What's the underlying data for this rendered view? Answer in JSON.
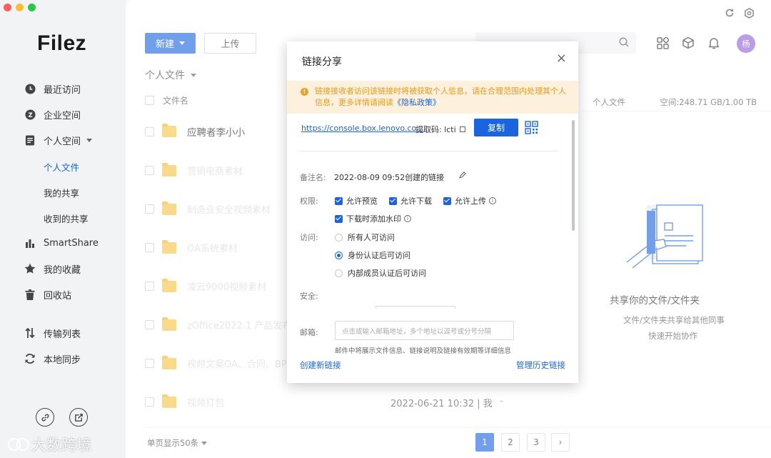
{
  "app": {
    "logo": "Filez"
  },
  "colors": {
    "accent": "#1a64e0",
    "warning_bg": "#fdf0dc",
    "warning_text": "#e79a1c",
    "avatar": "#8e62d9",
    "folder": "#f6c343"
  },
  "sidebar": {
    "items": [
      {
        "label": "最近访问",
        "icon": "clock-icon"
      },
      {
        "label": "企业空间",
        "icon": "enterprise-icon"
      },
      {
        "label": "个人空间",
        "icon": "personal-space-icon"
      },
      {
        "label": "SmartShare",
        "icon": "bar-chart-icon"
      },
      {
        "label": "我的收藏",
        "icon": "star-icon"
      },
      {
        "label": "回收站",
        "icon": "trash-icon"
      },
      {
        "label": "传输列表",
        "icon": "transfer-icon"
      },
      {
        "label": "本地同步",
        "icon": "sync-icon"
      }
    ],
    "sub_items": [
      "个人文件",
      "我的共享",
      "收到的共享"
    ]
  },
  "toolbar": {
    "new_label": "新建",
    "upload_label": "上传",
    "breadcrumb": "个人文件"
  },
  "table": {
    "header_name": "文件名",
    "rows": [
      {
        "name": "应聘者李小小"
      },
      {
        "name": "营销电商素材"
      },
      {
        "name": "制造业安全视频素材"
      },
      {
        "name": "OA系统素材"
      },
      {
        "name": "凌云9000视频素材"
      },
      {
        "name": "zOffice2022.1 产品发布"
      },
      {
        "name": "视频文案OA、合同、BPM"
      },
      {
        "name": "视频打包"
      }
    ],
    "last_row_date": "2022-06-21 10:32 | 我",
    "last_row_dash": "-"
  },
  "right_panel": {
    "location": "个人文件",
    "space": "空间:248.71 GB/1.00 TB",
    "title": "共享你的文件/文件夹",
    "desc1": "文件/文件夹共享给其他同事",
    "desc2": "快速开始协作"
  },
  "header": {
    "avatar_text": "杨"
  },
  "pagination": {
    "page_size": "单页显示50条",
    "pages": [
      "1",
      "2",
      "3"
    ],
    "next": "›",
    "active": "1"
  },
  "modal": {
    "title": "链接分享",
    "close": "×",
    "warning_text": "链接接收者访问该链接时将被获取个人信息，请在合理范围内处理其个人信息，更多详情请阅读",
    "warning_link": "《隐私政策》",
    "link_url": "https://console.box.lenovo.co...",
    "code_label": "提取码: lcti",
    "copy_label": "复制",
    "remark_label": "备注名:",
    "remark_value": "2022-08-09 09:52创建的链接",
    "perm_label": "权限:",
    "perms": [
      "允许预览",
      "允许下载",
      "允许上传",
      "下载时添加水印"
    ],
    "access_label": "访问:",
    "access_options": [
      "所有人可访问",
      "身份认证后可访问",
      "内部成员认证后可访问"
    ],
    "access_selected": "身份认证后可访问",
    "security_label": "安全:",
    "email_label": "邮箱:",
    "email_placeholder": "点击或输入邮箱地址，多个地址以逗号或分号分隔",
    "email_note": "邮件中将展示文件信息、链接说明及链接有效期等详细信息",
    "create_link": "创建新链接",
    "manage_history": "管理历史链接"
  },
  "watermark": {
    "text": "大数跨境"
  }
}
